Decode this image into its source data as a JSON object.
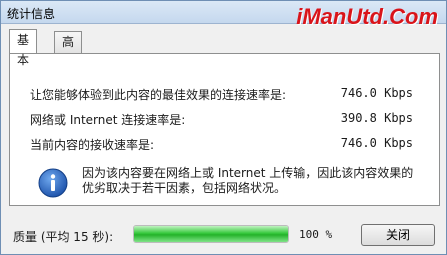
{
  "window": {
    "title": "统计信息"
  },
  "watermark": {
    "text": "iManUtd.Com",
    "color": "#d9141a"
  },
  "tabs": [
    {
      "label": "基本",
      "active": true
    },
    {
      "label": "高级",
      "active": false
    }
  ],
  "stats": [
    {
      "label": "让您能够体验到此内容的最佳效果的连接速率是:",
      "value": "746.0 Kbps"
    },
    {
      "label": "网络或 Internet 连接速率是:",
      "value": "390.8 Kbps"
    },
    {
      "label": "当前内容的接收速率是:",
      "value": "746.0 Kbps"
    }
  ],
  "info": {
    "icon": "info-icon",
    "text": "因为该内容要在网络上或 Internet 上传输，因此该内容效果的优劣取决于若干因素，包括网络状况。"
  },
  "quality": {
    "label": "质量 (平均 15 秒):",
    "percent_text": "100 %",
    "fill_fraction": 1.0,
    "fill_color": "#2bbd31"
  },
  "buttons": {
    "close_label": "关闭"
  }
}
